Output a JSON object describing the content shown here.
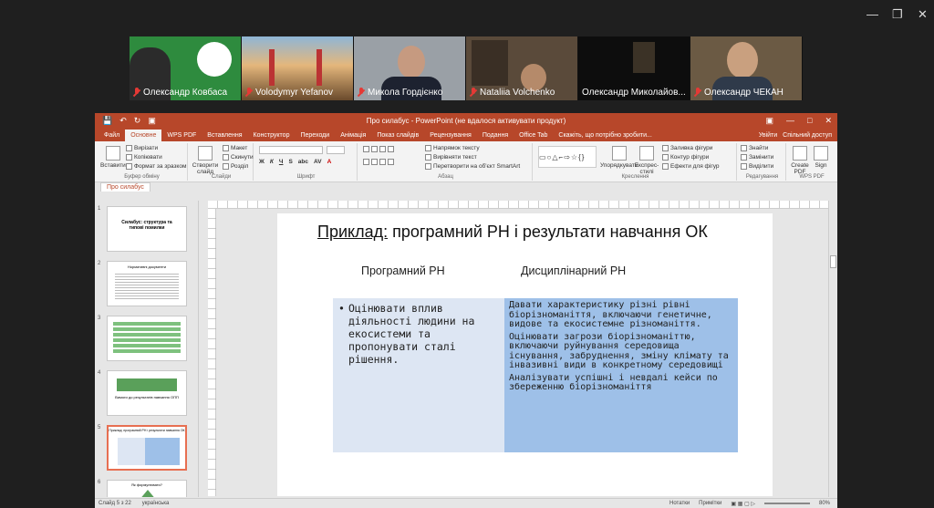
{
  "participants": [
    {
      "name": "Олександр Ковбаса",
      "bg": "#2e8b3e"
    },
    {
      "name": "Volodymyr Yefanov",
      "bg": "#c07a42"
    },
    {
      "name": "Микола Гордієнко",
      "bg": "#9aa0a6"
    },
    {
      "name": "Nataliia Volchenko",
      "bg": "#5a4a3a"
    },
    {
      "name": "Олександр Миколайов...",
      "bg": "#0d0d0d"
    },
    {
      "name": "Олександр ЧЕКАН",
      "bg": "#6b5a44"
    }
  ],
  "window": {
    "title": "Про силабус - PowerPoint (не вдалося активувати продукт)"
  },
  "tabs": [
    "Файл",
    "Основне",
    "WPS PDF",
    "Вставлення",
    "Конструктор",
    "Переходи",
    "Анімація",
    "Показ слайдів",
    "Рецензування",
    "Подання",
    "Office Tab",
    "Скажіть, що потрібно зробити..."
  ],
  "tabs_right": [
    "Увійти",
    "Спільний доступ"
  ],
  "ribbon": {
    "paste": "Вставити",
    "cut": "Вирізати",
    "copy": "Копіювати",
    "format_painter": "Формат за зразком",
    "clipboard_group": "Буфер обміну",
    "new_slide": "Створити слайд",
    "layout": "Макет",
    "reset": "Скинути",
    "section": "Розділ",
    "slides_group": "Слайди",
    "font_group": "Шрифт",
    "text_direction": "Напрямок тексту",
    "align_text": "Вирівняти текст",
    "smartart": "Перетворити на об'єкт SmartArt",
    "paragraph_group": "Абзац",
    "arrange": "Упорядкувати",
    "quick_styles": "Експрес-стилі",
    "shape_fill": "Заливка фігури",
    "shape_outline": "Контур фігури",
    "shape_effects": "Ефекти для фігур",
    "drawing_group": "Креслення",
    "find": "Знайти",
    "replace": "Замінити",
    "select": "Виділити",
    "editing_group": "Редагування",
    "create_pdf": "Create PDF",
    "sign": "Sign",
    "wps_group": "WPS PDF"
  },
  "doc_tab": "Про силабус",
  "thumbnails": [
    {
      "num": "1",
      "text": "Силабус: структура та типові помилки"
    },
    {
      "num": "2",
      "text": "Нормативні документи"
    },
    {
      "num": "3",
      "text": ""
    },
    {
      "num": "4",
      "text": "Вимоги до результатів навчання ОПП"
    },
    {
      "num": "5",
      "text": "Приклад: програмний РН і результати навчання ОК"
    },
    {
      "num": "6",
      "text": "Як формулювати?"
    }
  ],
  "slide": {
    "title_prefix": "Приклад:",
    "title_rest": " програмний РН і результати навчання ОК",
    "col_left": "Програмний РН",
    "col_right": "Дисциплінарний РН",
    "left_bullet": "•",
    "left_text": "Оцінювати вплив діяльності людини на екосистеми та пропонувати сталі рішення.",
    "right_paragraphs": [
      "Давати характеристику різні рівні біорізноманіття, включаючи генетичне, видове та екосистемне різноманіття.",
      "Оцінювати загрози біорізноманіттю, включаючи руйнування середовища існування, забруднення, зміну клімату та інвазивні види в конкретному середовищі",
      "Аналізувати успішні і невдалі кейси по збереженню біорізноманіття"
    ]
  },
  "status": {
    "slide": "Слайд 5 з 22",
    "lang": "українська",
    "notes": "Нотатки",
    "comments": "Примітки",
    "zoom": "80%"
  },
  "colors": {
    "accent": "#b7472a",
    "table_left": "#dde6f3",
    "table_right": "#9ec0e8"
  }
}
